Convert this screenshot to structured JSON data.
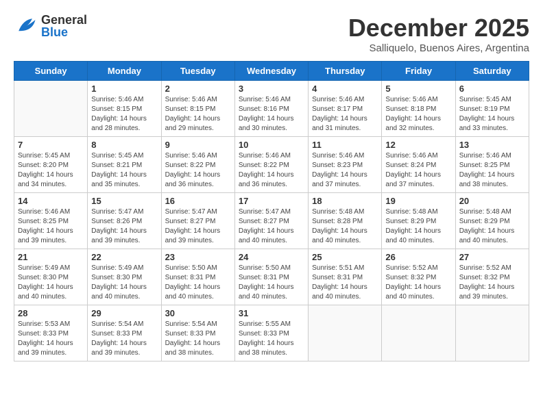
{
  "header": {
    "logo": {
      "general": "General",
      "blue": "Blue"
    },
    "title": "December 2025",
    "subtitle": "Salliquelo, Buenos Aires, Argentina"
  },
  "weekdays": [
    "Sunday",
    "Monday",
    "Tuesday",
    "Wednesday",
    "Thursday",
    "Friday",
    "Saturday"
  ],
  "weeks": [
    [
      {
        "day": "",
        "info": ""
      },
      {
        "day": "1",
        "info": "Sunrise: 5:46 AM\nSunset: 8:15 PM\nDaylight: 14 hours\nand 28 minutes."
      },
      {
        "day": "2",
        "info": "Sunrise: 5:46 AM\nSunset: 8:15 PM\nDaylight: 14 hours\nand 29 minutes."
      },
      {
        "day": "3",
        "info": "Sunrise: 5:46 AM\nSunset: 8:16 PM\nDaylight: 14 hours\nand 30 minutes."
      },
      {
        "day": "4",
        "info": "Sunrise: 5:46 AM\nSunset: 8:17 PM\nDaylight: 14 hours\nand 31 minutes."
      },
      {
        "day": "5",
        "info": "Sunrise: 5:46 AM\nSunset: 8:18 PM\nDaylight: 14 hours\nand 32 minutes."
      },
      {
        "day": "6",
        "info": "Sunrise: 5:45 AM\nSunset: 8:19 PM\nDaylight: 14 hours\nand 33 minutes."
      }
    ],
    [
      {
        "day": "7",
        "info": "Sunrise: 5:45 AM\nSunset: 8:20 PM\nDaylight: 14 hours\nand 34 minutes."
      },
      {
        "day": "8",
        "info": "Sunrise: 5:45 AM\nSunset: 8:21 PM\nDaylight: 14 hours\nand 35 minutes."
      },
      {
        "day": "9",
        "info": "Sunrise: 5:46 AM\nSunset: 8:22 PM\nDaylight: 14 hours\nand 36 minutes."
      },
      {
        "day": "10",
        "info": "Sunrise: 5:46 AM\nSunset: 8:22 PM\nDaylight: 14 hours\nand 36 minutes."
      },
      {
        "day": "11",
        "info": "Sunrise: 5:46 AM\nSunset: 8:23 PM\nDaylight: 14 hours\nand 37 minutes."
      },
      {
        "day": "12",
        "info": "Sunrise: 5:46 AM\nSunset: 8:24 PM\nDaylight: 14 hours\nand 37 minutes."
      },
      {
        "day": "13",
        "info": "Sunrise: 5:46 AM\nSunset: 8:25 PM\nDaylight: 14 hours\nand 38 minutes."
      }
    ],
    [
      {
        "day": "14",
        "info": "Sunrise: 5:46 AM\nSunset: 8:25 PM\nDaylight: 14 hours\nand 39 minutes."
      },
      {
        "day": "15",
        "info": "Sunrise: 5:47 AM\nSunset: 8:26 PM\nDaylight: 14 hours\nand 39 minutes."
      },
      {
        "day": "16",
        "info": "Sunrise: 5:47 AM\nSunset: 8:27 PM\nDaylight: 14 hours\nand 39 minutes."
      },
      {
        "day": "17",
        "info": "Sunrise: 5:47 AM\nSunset: 8:27 PM\nDaylight: 14 hours\nand 40 minutes."
      },
      {
        "day": "18",
        "info": "Sunrise: 5:48 AM\nSunset: 8:28 PM\nDaylight: 14 hours\nand 40 minutes."
      },
      {
        "day": "19",
        "info": "Sunrise: 5:48 AM\nSunset: 8:29 PM\nDaylight: 14 hours\nand 40 minutes."
      },
      {
        "day": "20",
        "info": "Sunrise: 5:48 AM\nSunset: 8:29 PM\nDaylight: 14 hours\nand 40 minutes."
      }
    ],
    [
      {
        "day": "21",
        "info": "Sunrise: 5:49 AM\nSunset: 8:30 PM\nDaylight: 14 hours\nand 40 minutes."
      },
      {
        "day": "22",
        "info": "Sunrise: 5:49 AM\nSunset: 8:30 PM\nDaylight: 14 hours\nand 40 minutes."
      },
      {
        "day": "23",
        "info": "Sunrise: 5:50 AM\nSunset: 8:31 PM\nDaylight: 14 hours\nand 40 minutes."
      },
      {
        "day": "24",
        "info": "Sunrise: 5:50 AM\nSunset: 8:31 PM\nDaylight: 14 hours\nand 40 minutes."
      },
      {
        "day": "25",
        "info": "Sunrise: 5:51 AM\nSunset: 8:31 PM\nDaylight: 14 hours\nand 40 minutes."
      },
      {
        "day": "26",
        "info": "Sunrise: 5:52 AM\nSunset: 8:32 PM\nDaylight: 14 hours\nand 40 minutes."
      },
      {
        "day": "27",
        "info": "Sunrise: 5:52 AM\nSunset: 8:32 PM\nDaylight: 14 hours\nand 39 minutes."
      }
    ],
    [
      {
        "day": "28",
        "info": "Sunrise: 5:53 AM\nSunset: 8:33 PM\nDaylight: 14 hours\nand 39 minutes."
      },
      {
        "day": "29",
        "info": "Sunrise: 5:54 AM\nSunset: 8:33 PM\nDaylight: 14 hours\nand 39 minutes."
      },
      {
        "day": "30",
        "info": "Sunrise: 5:54 AM\nSunset: 8:33 PM\nDaylight: 14 hours\nand 38 minutes."
      },
      {
        "day": "31",
        "info": "Sunrise: 5:55 AM\nSunset: 8:33 PM\nDaylight: 14 hours\nand 38 minutes."
      },
      {
        "day": "",
        "info": ""
      },
      {
        "day": "",
        "info": ""
      },
      {
        "day": "",
        "info": ""
      }
    ]
  ]
}
